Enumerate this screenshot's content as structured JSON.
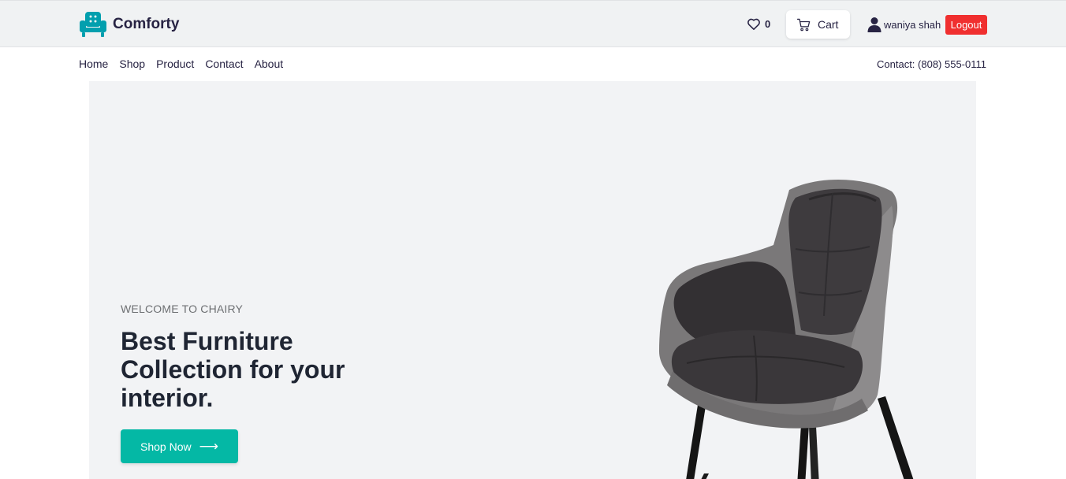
{
  "brand": {
    "name": "Comforty",
    "accent": "#029fae",
    "icon": "armchair-icon"
  },
  "header": {
    "wishlist": {
      "icon": "heart-icon",
      "count": "0"
    },
    "cart": {
      "icon": "cart-icon",
      "label": "Cart"
    },
    "user": {
      "icon": "user-icon",
      "name": "waniya shah"
    },
    "logout_label": "Logout",
    "logout_color": "#f02f2f"
  },
  "nav": {
    "items": [
      {
        "label": "Home"
      },
      {
        "label": "Shop"
      },
      {
        "label": "Product"
      },
      {
        "label": "Contact"
      },
      {
        "label": "About"
      }
    ],
    "contact": "Contact: (808) 555-0111"
  },
  "hero": {
    "eyebrow": "WELCOME TO CHAIRY",
    "headline": "Best Furniture Collection for your interior.",
    "cta_label": "Shop Now",
    "cta_icon": "arrow-right-icon",
    "cta_color": "#04b8a5",
    "image": "armchair-product-image"
  }
}
